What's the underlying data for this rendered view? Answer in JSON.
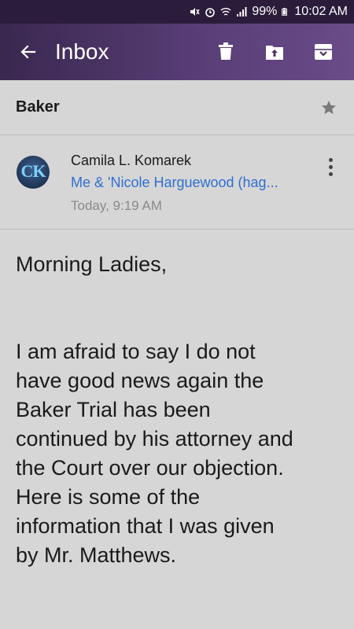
{
  "status_bar": {
    "battery": "99%",
    "time": "10:02 AM"
  },
  "app_bar": {
    "title": "Inbox",
    "back_icon": "arrow-back-icon",
    "actions": [
      "delete-icon",
      "move-to-folder-icon",
      "archive-icon"
    ]
  },
  "email": {
    "subject": "Baker",
    "sender_initials": "CK",
    "sender_name": "Camila L. Komarek",
    "recipients": "Me & 'Nicole Harguewood (hag...",
    "date": "Today, 9:19 AM",
    "body": {
      "greeting": "Morning Ladies,",
      "paragraph": "I am afraid to say I do not\nhave good news again the\nBaker Trial has been\ncontinued by his attorney and\nthe Court over our objection.\nHere is some of the\ninformation that I was given\nby Mr. Matthews."
    }
  },
  "colors": {
    "app_bar": "#4a3466",
    "background": "#d6d6d6",
    "link": "#2f6fd0"
  }
}
